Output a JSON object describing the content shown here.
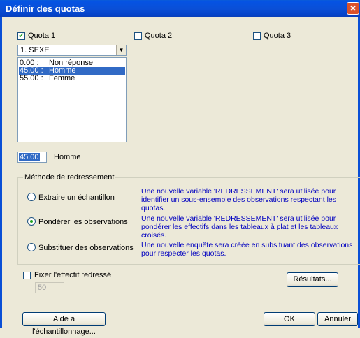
{
  "window": {
    "title": "Définir des quotas",
    "close_glyph": "✕"
  },
  "quotas": [
    {
      "label": "Quota 1",
      "checked": true
    },
    {
      "label": "Quota 2",
      "checked": false
    },
    {
      "label": "Quota 3",
      "checked": false
    }
  ],
  "variable_select": {
    "value": "1. SEXE"
  },
  "quota_list": [
    {
      "value": "0.00 :",
      "label": "Non réponse",
      "selected": false
    },
    {
      "value": "45.00 :",
      "label": "Homme",
      "selected": true
    },
    {
      "value": "55.00 :",
      "label": "Femme",
      "selected": false
    }
  ],
  "edit": {
    "value": "45.00",
    "label": "Homme"
  },
  "method": {
    "legend": "Méthode de redressement",
    "options": [
      {
        "label": "Extraire un échantillon",
        "selected": false,
        "desc": "Une nouvelle variable 'REDRESSEMENT' sera utilisée pour identifier un sous-ensemble des observations respectant les quotas."
      },
      {
        "label": "Pondérer les observations",
        "selected": true,
        "desc": "Une nouvelle variable 'REDRESSEMENT' sera utilisée pour pondérer les effectifs dans les tableaux à plat et les tableaux croisés."
      },
      {
        "label": "Substituer des observations",
        "selected": false,
        "desc": "Une nouvelle enquête sera créée en subsituant des observations pour respecter les quotas."
      }
    ]
  },
  "fix_effectif": {
    "label": "Fixer l'effectif redressé",
    "checked": false,
    "value": "50"
  },
  "buttons": {
    "results": "Résultats...",
    "help": "Aide à l'échantillonnage...",
    "ok": "OK",
    "cancel": "Annuler"
  }
}
